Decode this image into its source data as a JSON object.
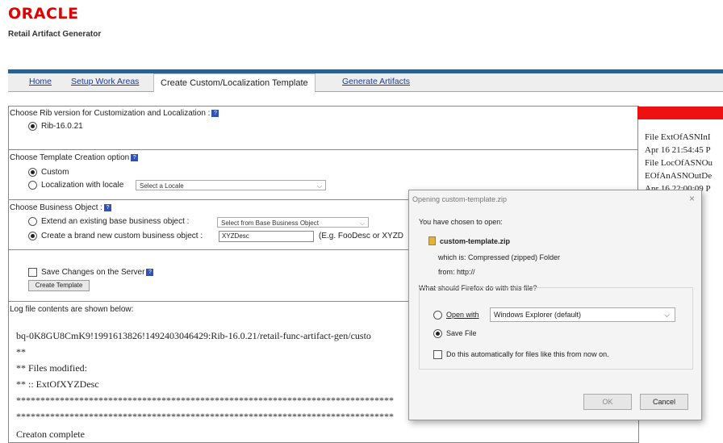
{
  "header": {
    "logo": "ORACLE",
    "subtitle": "Retail Artifact Generator"
  },
  "tabs": [
    {
      "label": "Home"
    },
    {
      "label": "Setup Work Areas"
    },
    {
      "label": "Create Custom/Localization Template"
    },
    {
      "label": "Generate Artifacts"
    }
  ],
  "rib": {
    "label": "Choose Rib version for Customization and Localization :",
    "option": "Rib-16.0.21"
  },
  "template": {
    "label": "Choose Template Creation option",
    "custom": "Custom",
    "localization": "Localization with locale",
    "locale_select": "Select a Locale"
  },
  "business": {
    "label": "Choose Business Object :",
    "extend": "Extend an existing base business object :",
    "extend_select": "Select from Base Business Object",
    "create": "Create a brand new custom business object :",
    "create_value": "XYZDesc",
    "hint": "(E.g. FooDesc or XYZD"
  },
  "save": {
    "label": "Save Changes on the Server",
    "button": "Create Template"
  },
  "log": {
    "label": "Log file contents are shown below:",
    "lines": [
      "bq-0K8GU8CmK9!1991613826!1492403046429:Rib-16.0.21/retail-func-artifact-gen/custo",
      "**",
      "** Files modified:",
      "** :: ExtOfXYZDesc",
      "******************************************************************************",
      "******************************************************************************",
      "Creaton complete"
    ]
  },
  "right_log": [
    "File ExtOfASNInI",
    "Apr 16 21:54:45 P",
    "File LocOfASNOu",
    "EOfAnASNOutDe",
    "Apr 16 22:00:09 P"
  ],
  "dialog": {
    "title": "Opening custom-template.zip",
    "close": "×",
    "intro": "You have chosen to open:",
    "filename": "custom-template.zip",
    "which_is": "which is: Compressed (zipped) Folder",
    "from": "from: http://",
    "question": "What should Firefox do with this file?",
    "open_with": "Open with",
    "open_with_app": "Windows Explorer (default)",
    "save_file": "Save File",
    "auto": "Do this automatically for files like this from now on.",
    "ok": "OK",
    "cancel": "Cancel"
  },
  "colors": {
    "brand": "#e00000",
    "accent_bar": "#2f5f8f",
    "alert": "#ee1111"
  }
}
